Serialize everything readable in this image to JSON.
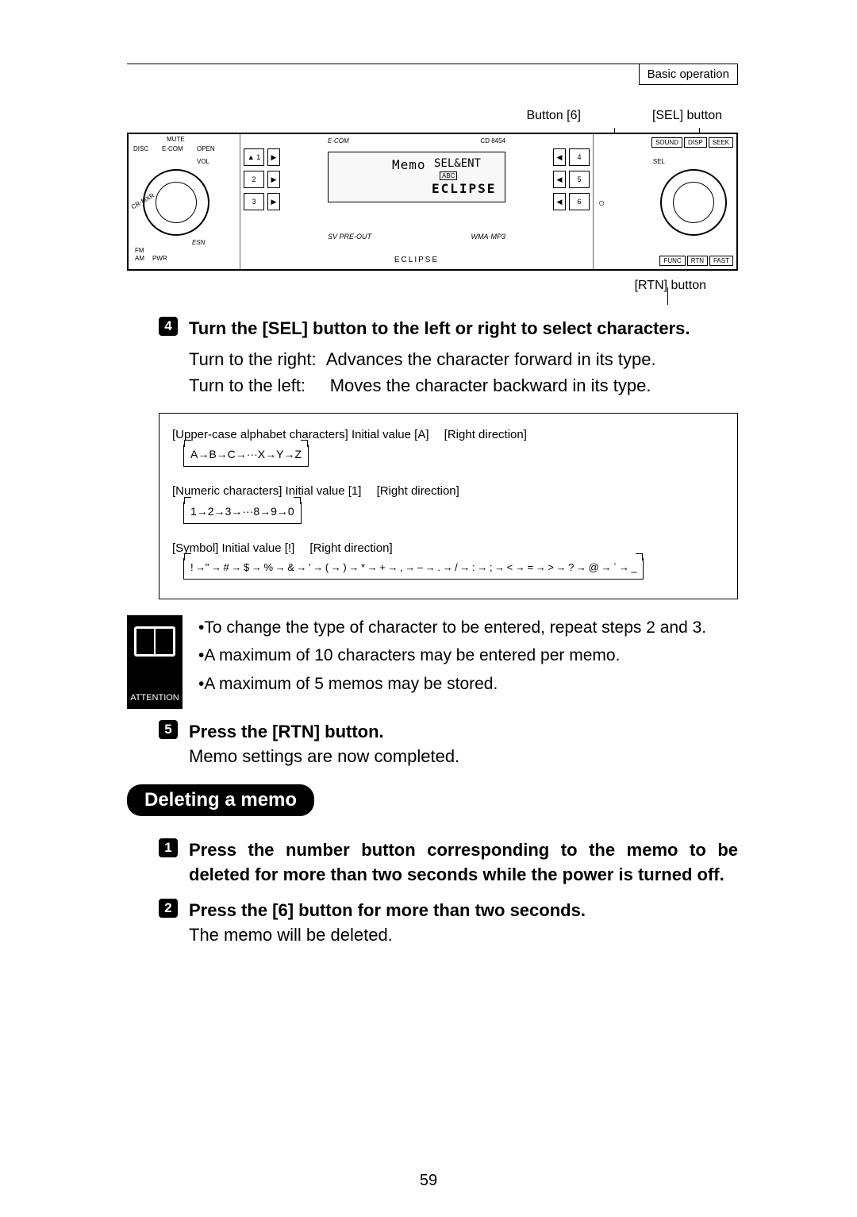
{
  "header": {
    "section_label": "Basic operation"
  },
  "figure": {
    "callout_button6": "Button [6]",
    "callout_sel": "[SEL] button",
    "callout_rtn": "[RTN] button",
    "faceplate": {
      "brand_top": "E-COM",
      "model": "CD 8454",
      "display_line1": "Memo",
      "display_line2": "SEL&ENT",
      "display_line3": "ECLIPSE",
      "display_sub_abc": "ABC",
      "left_tiny": [
        "MUTE",
        "DISC",
        "E-COM",
        "OPEN",
        "VOL",
        "CR-MXR",
        "ESN",
        "FM",
        "AM",
        "PWR"
      ],
      "right_tiny": [
        "SOUND",
        "DISP",
        "SEEK",
        "SEL",
        "FUNC",
        "RTN",
        "FAST"
      ],
      "num_col_left": [
        "1",
        "2",
        "3"
      ],
      "num_col_right": [
        "4",
        "5",
        "6"
      ],
      "arrow_fwd": "▶",
      "arrow_back": "◀",
      "bottom_brand": "ECLIPSE",
      "sub_sv": "SV PRE-OUT",
      "sub_wma": "WMA·MP3",
      "eject_icon": "▲",
      "circle_icon": "○"
    }
  },
  "step4": {
    "num": "4",
    "title": "Turn the [SEL] button to the left or right to select characters.",
    "line_right_label": "Turn to the right:",
    "line_right_body": "Advances the character forward in its type.",
    "line_left_label": "Turn to the left:",
    "line_left_body": "Moves the character backward in its type."
  },
  "char_table": {
    "row1_title": "[Upper-case alphabet characters] Initial value [A]  [Right direction]",
    "row1_seq": "A→B→C→···X→Y→Z",
    "row2_title": "[Numeric characters] Initial value [1]  [Right direction]",
    "row2_seq": "1→2→3→···8→9→0",
    "row3_title": "[Symbol] Initial value [!]  [Right direction]",
    "row3_seq": "! →\" → # → $ → % → & → ' → ( → ) → * → + → , → – → . → / → : → ; → < → = → > → ? → @ → ´ → _"
  },
  "attention": {
    "label": "ATTENTION",
    "b1": "•To change the type of character to be entered, repeat steps 2 and 3.",
    "b2": "•A maximum of 10 characters may be entered per memo.",
    "b3": "•A maximum of 5 memos may be stored."
  },
  "step5": {
    "num": "5",
    "title": "Press the [RTN] button.",
    "body": "Memo settings are now completed."
  },
  "section2": {
    "heading": "Deleting a memo"
  },
  "del_step1": {
    "num": "1",
    "title": "Press the number button corresponding to the memo to be deleted for more than two seconds while the power is turned off."
  },
  "del_step2": {
    "num": "2",
    "title": "Press the [6] button for more than two seconds.",
    "body": "The memo will be deleted."
  },
  "page_number": "59"
}
